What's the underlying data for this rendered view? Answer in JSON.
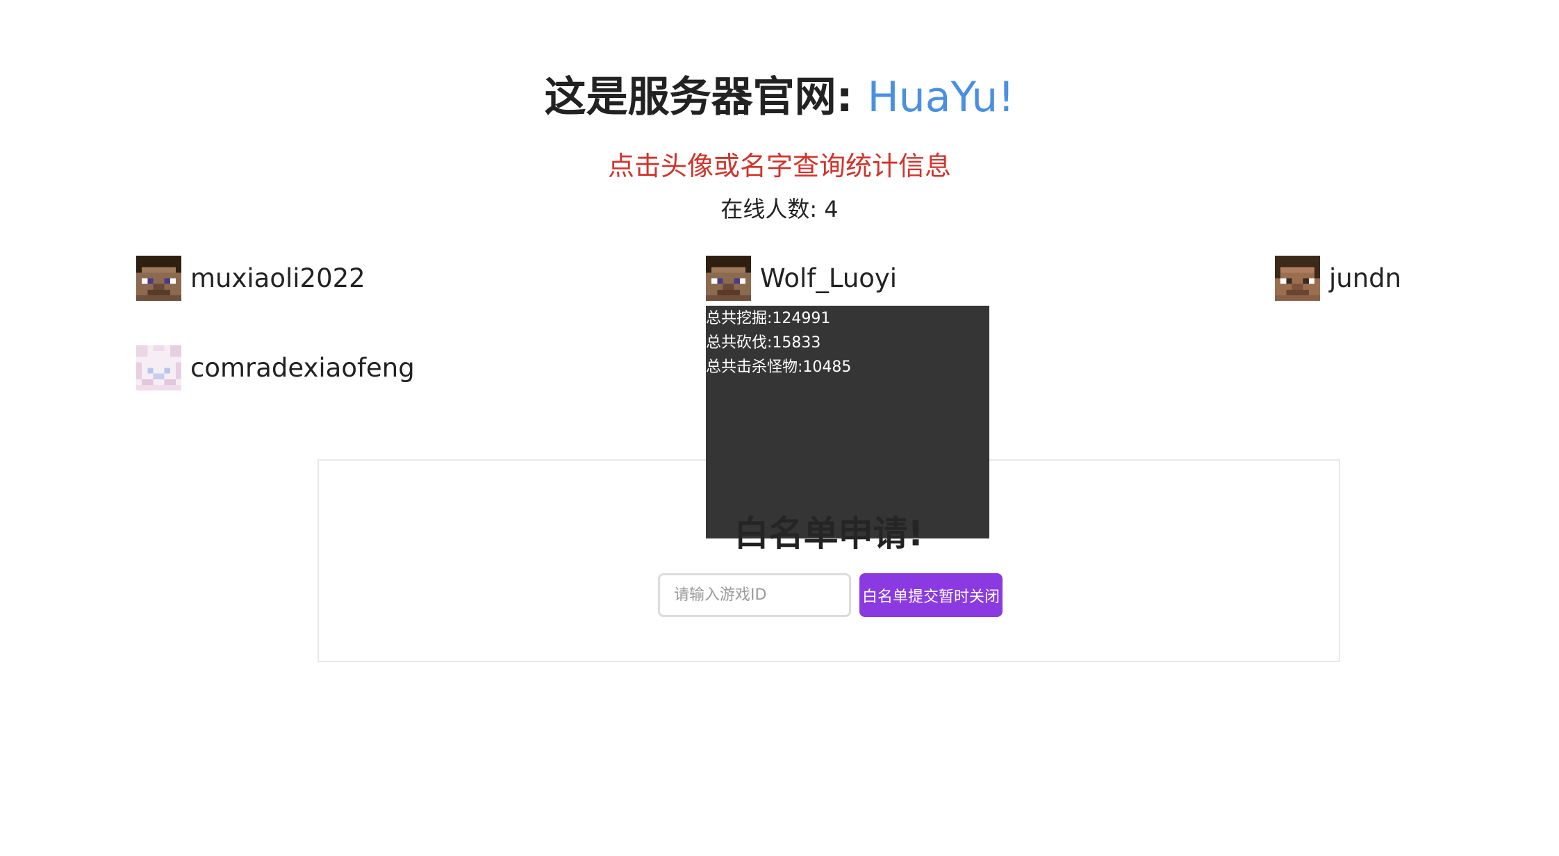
{
  "header": {
    "title_prefix": "这是服务器官网: ",
    "title_brand": "HuaYu!",
    "subtitle": "点击头像或名字查询统计信息",
    "online_label": "在线人数: 4"
  },
  "colors": {
    "brand": "#4a90e2",
    "subtitle": "#d0342c",
    "button": "#8a3ae0",
    "popup_bg": "#262626"
  },
  "players": [
    {
      "name": "muxiaoli2022",
      "avatar": "steve-head-avatar"
    },
    {
      "name": "Wolf_Luoyi",
      "avatar": "steve-head-avatar"
    },
    {
      "name": "jundn",
      "avatar": "steve-head-avatar"
    },
    {
      "name": "comradexiaofeng",
      "avatar": "pink-skin-avatar"
    }
  ],
  "stats_popup": {
    "player": "Wolf_Luoyi",
    "lines": [
      "总共挖掘:124991",
      "总共砍伐:15833",
      "总共击杀怪物:10485"
    ]
  },
  "whitelist": {
    "title": "白名单申请!",
    "input_placeholder": "请输入游戏ID",
    "input_value": "",
    "button_label": "白名单提交暂时关闭"
  }
}
